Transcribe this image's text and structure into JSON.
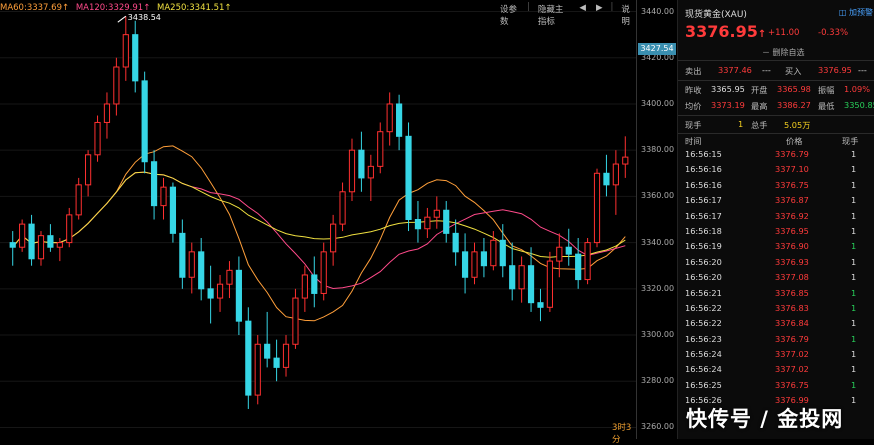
{
  "ma_legend": [
    {
      "text": "MA60:3337.69↑",
      "color": "#ff9f3a"
    },
    {
      "text": "MA120:3329.91↑",
      "color": "#ff4a8a"
    },
    {
      "text": "MA250:3341.51↑",
      "color": "#f0e040"
    }
  ],
  "toolbar": {
    "params": "设参数",
    "hide_indicator": "隐藏主指标",
    "back": "◀",
    "forward": "▶",
    "help": "说明"
  },
  "time_label": "3时3分",
  "high_label": "3438.54",
  "price_axis": {
    "ticks": [
      "3440.00",
      "3420.00",
      "3400.00",
      "3380.00",
      "3360.00",
      "3340.00",
      "3320.00",
      "3300.00",
      "3280.00",
      "3260.00"
    ]
  },
  "current_price_tag": "3427.54",
  "quote": {
    "name": "现货黄金(XAU)",
    "add_watch": "加预警",
    "last": "3376.95",
    "arrow": "↑",
    "change": "+11.00",
    "change_pct": "-0.33%",
    "remove_watch": "－ 删除自选",
    "sell_label": "卖出",
    "sell_val": "3377.46",
    "sell_dash": "---",
    "buy_label": "买入",
    "buy_val": "3376.95",
    "buy_dash": "---",
    "prev_label": "昨收",
    "prev_val": "3365.95",
    "open_label": "开盘",
    "open_val": "3365.98",
    "amp_label": "振幅",
    "amp_val": "1.09%",
    "avg_label": "均价",
    "avg_val": "3373.19",
    "high_label": "最高",
    "high_val": "3386.27",
    "low_label": "最低",
    "low_val": "3350.85",
    "cur_hand_label": "现手",
    "cur_hand_val": "1",
    "total_hand_label": "总手",
    "total_hand_val": "5.05万",
    "col_time": "时间",
    "col_price": "价格",
    "col_hand": "现手"
  },
  "ticks": [
    {
      "time": "16:56:15",
      "price": "3376.79",
      "vol": "1",
      "vol_color": "white"
    },
    {
      "time": "16:56:16",
      "price": "3377.10",
      "vol": "1",
      "vol_color": "white"
    },
    {
      "time": "16:56:16",
      "price": "3376.75",
      "vol": "1",
      "vol_color": "white"
    },
    {
      "time": "16:56:17",
      "price": "3376.87",
      "vol": "1",
      "vol_color": "white"
    },
    {
      "time": "16:56:17",
      "price": "3376.92",
      "vol": "1",
      "vol_color": "white"
    },
    {
      "time": "16:56:18",
      "price": "3376.95",
      "vol": "1",
      "vol_color": "white"
    },
    {
      "time": "16:56:19",
      "price": "3376.90",
      "vol": "1",
      "vol_color": "green"
    },
    {
      "time": "16:56:20",
      "price": "3376.93",
      "vol": "1",
      "vol_color": "white"
    },
    {
      "time": "16:56:20",
      "price": "3377.08",
      "vol": "1",
      "vol_color": "white"
    },
    {
      "time": "16:56:21",
      "price": "3376.85",
      "vol": "1",
      "vol_color": "green"
    },
    {
      "time": "16:56:22",
      "price": "3376.83",
      "vol": "1",
      "vol_color": "green"
    },
    {
      "time": "16:56:22",
      "price": "3376.84",
      "vol": "1",
      "vol_color": "white"
    },
    {
      "time": "16:56:23",
      "price": "3376.79",
      "vol": "1",
      "vol_color": "green"
    },
    {
      "time": "16:56:24",
      "price": "3377.02",
      "vol": "1",
      "vol_color": "white"
    },
    {
      "time": "16:56:24",
      "price": "3377.02",
      "vol": "1",
      "vol_color": "white"
    },
    {
      "time": "16:56:25",
      "price": "3376.75",
      "vol": "1",
      "vol_color": "green"
    },
    {
      "time": "16:56:26",
      "price": "3376.99",
      "vol": "1",
      "vol_color": "white"
    }
  ],
  "footer_brand": "快传号 / 金投网",
  "chart_data": {
    "type": "candlestick",
    "ylim": [
      3255,
      3445
    ],
    "up_color": "#ff3030",
    "down_color": "#36d6e6",
    "candles": [
      [
        3340,
        3345,
        3330,
        3338
      ],
      [
        3338,
        3350,
        3336,
        3348
      ],
      [
        3348,
        3352,
        3330,
        3333
      ],
      [
        3333,
        3345,
        3330,
        3343
      ],
      [
        3343,
        3348,
        3336,
        3338
      ],
      [
        3338,
        3342,
        3332,
        3340
      ],
      [
        3340,
        3355,
        3338,
        3352
      ],
      [
        3352,
        3368,
        3350,
        3365
      ],
      [
        3365,
        3380,
        3360,
        3378
      ],
      [
        3378,
        3395,
        3375,
        3392
      ],
      [
        3392,
        3405,
        3385,
        3400
      ],
      [
        3400,
        3420,
        3395,
        3416
      ],
      [
        3416,
        3438,
        3410,
        3430
      ],
      [
        3430,
        3436,
        3405,
        3410
      ],
      [
        3410,
        3414,
        3370,
        3375
      ],
      [
        3375,
        3380,
        3350,
        3356
      ],
      [
        3356,
        3368,
        3350,
        3364
      ],
      [
        3364,
        3366,
        3340,
        3344
      ],
      [
        3344,
        3350,
        3320,
        3325
      ],
      [
        3325,
        3340,
        3318,
        3336
      ],
      [
        3336,
        3342,
        3315,
        3320
      ],
      [
        3320,
        3330,
        3305,
        3316
      ],
      [
        3316,
        3326,
        3310,
        3322
      ],
      [
        3322,
        3332,
        3316,
        3328
      ],
      [
        3328,
        3334,
        3300,
        3306
      ],
      [
        3306,
        3312,
        3268,
        3274
      ],
      [
        3274,
        3300,
        3270,
        3296
      ],
      [
        3296,
        3310,
        3286,
        3290
      ],
      [
        3290,
        3298,
        3280,
        3286
      ],
      [
        3286,
        3300,
        3282,
        3296
      ],
      [
        3296,
        3320,
        3294,
        3316
      ],
      [
        3316,
        3330,
        3310,
        3326
      ],
      [
        3326,
        3334,
        3312,
        3318
      ],
      [
        3318,
        3340,
        3315,
        3336
      ],
      [
        3336,
        3352,
        3330,
        3348
      ],
      [
        3348,
        3366,
        3345,
        3362
      ],
      [
        3362,
        3385,
        3358,
        3380
      ],
      [
        3380,
        3388,
        3362,
        3368
      ],
      [
        3368,
        3378,
        3358,
        3373
      ],
      [
        3373,
        3392,
        3370,
        3388
      ],
      [
        3388,
        3405,
        3382,
        3400
      ],
      [
        3400,
        3404,
        3380,
        3386
      ],
      [
        3386,
        3392,
        3345,
        3350
      ],
      [
        3350,
        3358,
        3340,
        3346
      ],
      [
        3346,
        3355,
        3342,
        3351
      ],
      [
        3351,
        3360,
        3346,
        3354
      ],
      [
        3354,
        3358,
        3340,
        3344
      ],
      [
        3344,
        3350,
        3330,
        3336
      ],
      [
        3336,
        3344,
        3318,
        3325
      ],
      [
        3325,
        3340,
        3322,
        3336
      ],
      [
        3336,
        3342,
        3325,
        3330
      ],
      [
        3330,
        3345,
        3328,
        3341
      ],
      [
        3341,
        3348,
        3325,
        3330
      ],
      [
        3330,
        3340,
        3315,
        3320
      ],
      [
        3320,
        3334,
        3314,
        3330
      ],
      [
        3330,
        3338,
        3310,
        3314
      ],
      [
        3314,
        3320,
        3306,
        3312
      ],
      [
        3312,
        3336,
        3310,
        3332
      ],
      [
        3332,
        3344,
        3325,
        3338
      ],
      [
        3338,
        3346,
        3330,
        3335
      ],
      [
        3335,
        3342,
        3320,
        3324
      ],
      [
        3324,
        3342,
        3322,
        3340
      ],
      [
        3340,
        3372,
        3338,
        3370
      ],
      [
        3370,
        3378,
        3360,
        3365
      ],
      [
        3365,
        3380,
        3352,
        3374
      ],
      [
        3374,
        3386,
        3368,
        3377
      ]
    ],
    "moving_averages": [
      {
        "name": "MA60",
        "color": "#ff9f3a"
      },
      {
        "name": "MA120",
        "color": "#ff4a8a"
      },
      {
        "name": "MA250",
        "color": "#f0e040"
      }
    ]
  }
}
